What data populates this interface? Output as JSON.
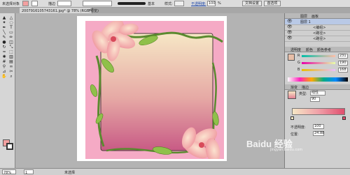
{
  "control_bar": {
    "selection_label": "未选择对象",
    "fill_label": "填色",
    "stroke_label": "描边",
    "brush_label": "基本",
    "style_label": "样式:",
    "opacity_label": "不透明度:",
    "opacity_value": "100",
    "opacity_unit": "%",
    "document_setup_label": "文档设置",
    "preferences_label": "首选项"
  },
  "document_tab": {
    "title": "2007916105743161.jpg* @ 78% (RGB/预览)",
    "close_glyph": "×"
  },
  "tools": [
    {
      "icon": "selection-arrow-icon",
      "glyph": "▲"
    },
    {
      "icon": "direct-selection-icon",
      "glyph": "△"
    },
    {
      "icon": "magic-wand-icon",
      "glyph": "✦"
    },
    {
      "icon": "lasso-icon",
      "glyph": "◌"
    },
    {
      "icon": "pen-icon",
      "glyph": "✒"
    },
    {
      "icon": "type-icon",
      "glyph": "T"
    },
    {
      "icon": "line-segment-icon",
      "glyph": "╲"
    },
    {
      "icon": "rectangle-icon",
      "glyph": "▭"
    },
    {
      "icon": "paintbrush-icon",
      "glyph": "✎"
    },
    {
      "icon": "pencil-icon",
      "glyph": "✏"
    },
    {
      "icon": "blob-brush-icon",
      "glyph": "●"
    },
    {
      "icon": "eraser-icon",
      "glyph": "◫"
    },
    {
      "icon": "rotate-icon",
      "glyph": "↻"
    },
    {
      "icon": "scale-icon",
      "glyph": "⤡"
    },
    {
      "icon": "warp-icon",
      "glyph": "≈"
    },
    {
      "icon": "free-transform-icon",
      "glyph": "⬚"
    },
    {
      "icon": "symbol-sprayer-icon",
      "glyph": "✺"
    },
    {
      "icon": "column-graph-icon",
      "glyph": "▥"
    },
    {
      "icon": "mesh-icon",
      "glyph": "#"
    },
    {
      "icon": "gradient-icon",
      "glyph": "▤"
    },
    {
      "icon": "eyedropper-icon",
      "glyph": "⚲"
    },
    {
      "icon": "blend-icon",
      "glyph": "∞"
    },
    {
      "icon": "slice-icon",
      "glyph": "⊿"
    },
    {
      "icon": "scissors-icon",
      "glyph": "✂"
    },
    {
      "icon": "hand-icon",
      "glyph": "✋"
    },
    {
      "icon": "zoom-icon",
      "glyph": "⌕"
    }
  ],
  "status_bar": {
    "zoom_value": "78%",
    "page_value": "1",
    "status_text": "未选择",
    "watermark": "Baidu 经验",
    "watermark_sub": "jingyan.baidu.com"
  },
  "layers_panel": {
    "tabs": [
      "图层",
      "画板"
    ],
    "rows": [
      {
        "label": "图层 1",
        "expanded": true
      },
      {
        "label": "<编组>",
        "expanded": false
      },
      {
        "label": "<路径>",
        "expanded": false
      },
      {
        "label": "<路径>",
        "expanded": false
      }
    ]
  },
  "color_panel": {
    "tabs": [
      "透明度",
      "颜色",
      "颜色参考"
    ],
    "channels": [
      {
        "name": "R",
        "value": "231"
      },
      {
        "name": "G",
        "value": "190"
      },
      {
        "name": "B",
        "value": "168"
      }
    ]
  },
  "gradient_panel": {
    "tabs": [
      "渐变",
      "描边"
    ],
    "type_label": "类型:",
    "type_value": "线性",
    "angle_value": "90",
    "opacity_label": "不透明度:",
    "opacity_value": "100",
    "location_label": "位置:",
    "location_value": "24.88"
  },
  "colors": {
    "gradient_top": "#f6e7c5",
    "gradient_bottom": "#c85a85",
    "frame_pink": "#f5aac5",
    "vine_green": "#5a8a2f"
  }
}
